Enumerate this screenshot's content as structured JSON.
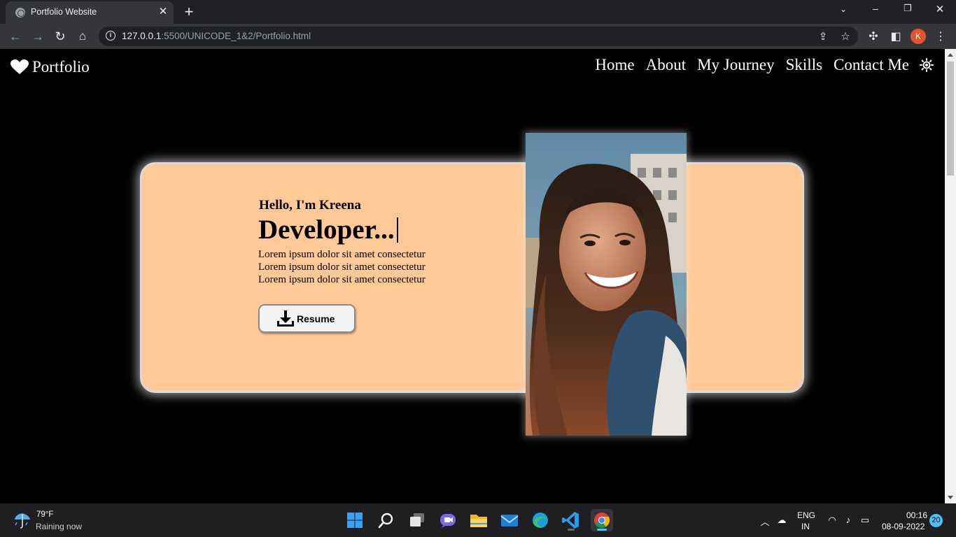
{
  "browser": {
    "tab_title": "Portfolio Website",
    "url_host": "127.0.0.1",
    "url_rest": ":5500/UNICODE_1&2/Portfolio.html",
    "profile_initial": "K"
  },
  "site": {
    "logo_text": "Portfolio",
    "nav": [
      "Home",
      "About",
      "My Journey",
      "Skills",
      "Contact Me"
    ],
    "hero": {
      "greeting": "Hello, I'm Kreena",
      "role": "Developer...",
      "description": [
        "Lorem ipsum dolor sit amet consectetur",
        "Lorem ipsum dolor sit amet consectetur",
        "Lorem ipsum dolor sit amet consectetur"
      ],
      "resume_label": "Resume"
    },
    "colors": {
      "card_bg": "#ffc897",
      "page_bg": "#000000"
    }
  },
  "taskbar": {
    "weather_temp": "79°F",
    "weather_condition": "Raining now",
    "lang_top": "ENG",
    "lang_bottom": "IN",
    "time": "00:16",
    "date": "08-09-2022",
    "notification_count": "20",
    "apps": [
      "start-icon",
      "search-icon",
      "task-view-icon",
      "chat-icon",
      "file-explorer-icon",
      "mail-icon",
      "edge-icon",
      "vscode-icon",
      "chrome-icon"
    ]
  }
}
